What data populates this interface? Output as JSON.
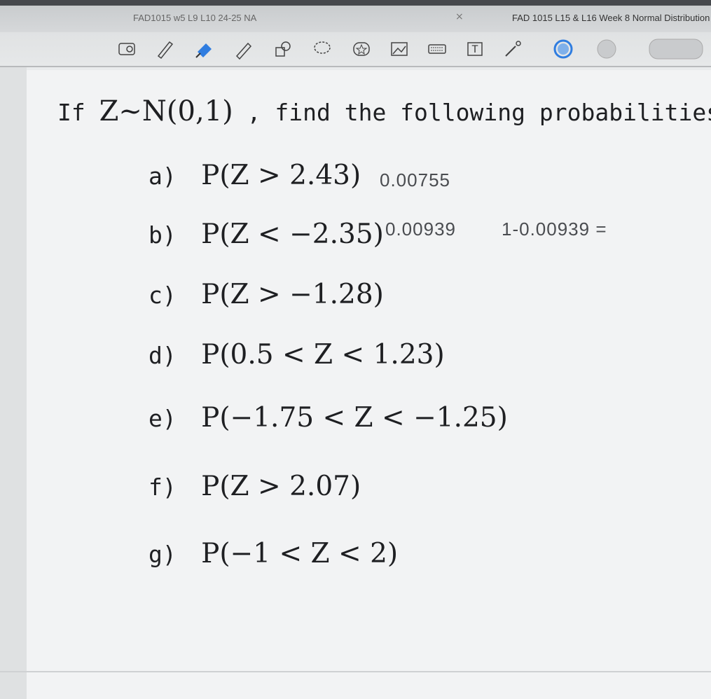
{
  "tabs": {
    "left_title": "FAD1015 w5 L9 L10 24-25 NA",
    "close_symbol": "×",
    "right_title": "FAD 1015 L15 & L16 Week 8 Normal Distribution"
  },
  "toolbar": {
    "tools": [
      "zoom-icon",
      "pen-icon",
      "highlighter-icon",
      "pencil-icon",
      "shapes-icon",
      "lasso-icon",
      "star-icon",
      "image-icon",
      "keyboard-icon",
      "text-icon",
      "laser-pointer-icon",
      "color-blue-icon",
      "color-gray-icon",
      "stroke-gray-icon"
    ],
    "text_tool_label": "T"
  },
  "worksheet": {
    "question_prefix": "If",
    "question_math": "Z~N(0,1)",
    "question_suffix": ", find the following probabilities.",
    "items": [
      {
        "label": "a)",
        "expr": "P(Z > 2.43)"
      },
      {
        "label": "b)",
        "expr": "P(Z < −2.35)"
      },
      {
        "label": "c)",
        "expr": "P(Z > −1.28)"
      },
      {
        "label": "d)",
        "expr": "P(0.5 < Z < 1.23)"
      },
      {
        "label": "e)",
        "expr": "P(−1.75 < Z < −1.25)"
      },
      {
        "label": "f)",
        "expr": "P(Z > 2.07)"
      },
      {
        "label": "g)",
        "expr": "P(−1 < Z < 2)"
      }
    ]
  },
  "handwriting": {
    "answer_a": "0.00755",
    "answer_b": "0.00939",
    "note_b": "1-0.00939 ="
  },
  "colors": {
    "accent_blue": "#2f7de0",
    "ink": "#1e1f22"
  }
}
